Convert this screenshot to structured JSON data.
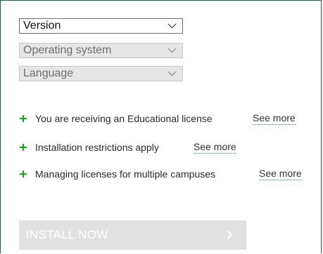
{
  "selects": [
    {
      "label": "Version",
      "state": "active"
    },
    {
      "label": "Operating system",
      "state": "disabled"
    },
    {
      "label": "Language",
      "state": "disabled"
    }
  ],
  "info_rows": [
    {
      "text": "You are receiving an Educational license",
      "link": "See more"
    },
    {
      "text": "Installation restrictions apply",
      "link": "See more"
    },
    {
      "text": "Managing licenses for multiple campuses",
      "link": "See more"
    }
  ],
  "install": {
    "label": "INSTALL NOW",
    "icon": "chevron-right-icon"
  },
  "colors": {
    "border": "#1e5a4f",
    "plus": "#2c9a2c",
    "link_underline": "#3a6b9a",
    "button_bg": "#e1e1e1"
  }
}
